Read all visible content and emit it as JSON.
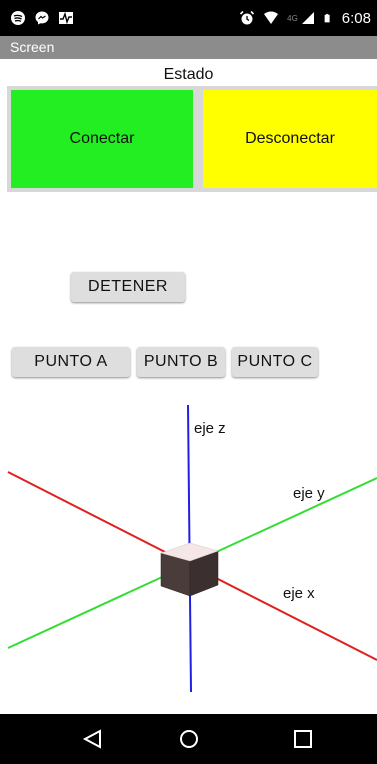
{
  "status_bar": {
    "time": "6:08",
    "network_label": "4G",
    "icons": [
      "spotify-icon",
      "messenger-icon",
      "activity-icon",
      "alarm-icon",
      "wifi-icon",
      "signal-icon",
      "battery-icon"
    ]
  },
  "app": {
    "title": "Screen",
    "state_label": "Estado"
  },
  "buttons": {
    "connect": "Conectar",
    "disconnect": "Desconectar",
    "stop": "DETENER",
    "point_a": "PUNTO A",
    "point_b": "PUNTO B",
    "point_c": "PUNTO C"
  },
  "scene": {
    "z_axis_label": "eje z",
    "y_axis_label": "eje y",
    "x_axis_label": "eje x",
    "colors": {
      "x_axis": "#e02020",
      "y_axis": "#33dd33",
      "z_axis": "#2020e0",
      "cube": "#4a3c3a"
    }
  },
  "nav": {
    "icons": [
      "back-icon",
      "home-icon",
      "recents-icon"
    ]
  },
  "colors": {
    "connect_bg": "#22ee22",
    "disconnect_bg": "#ffff00",
    "title_bar": "#8c8c8c"
  }
}
